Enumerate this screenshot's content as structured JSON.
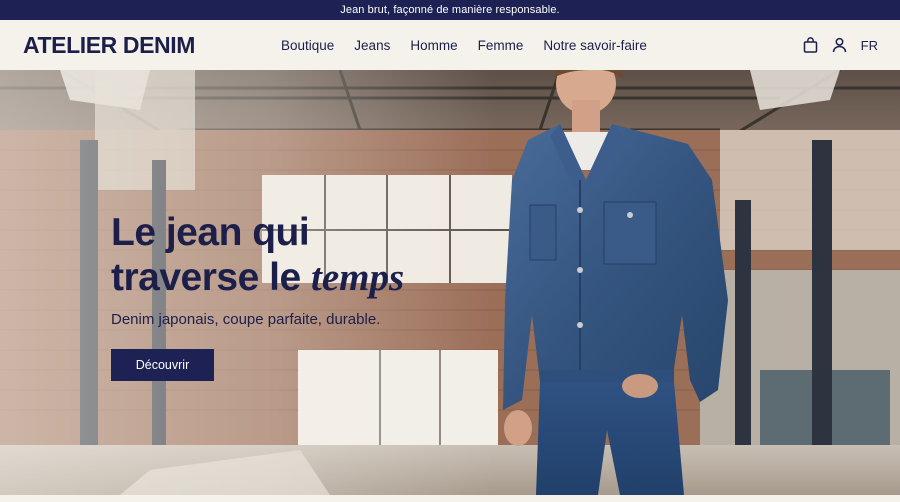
{
  "announcement": {
    "text": "Jean brut, façonné de manière responsable."
  },
  "header": {
    "logo": "ATELIER DENIM",
    "nav": [
      {
        "label": "Boutique"
      },
      {
        "label": "Jeans"
      },
      {
        "label": "Homme"
      },
      {
        "label": "Femme"
      },
      {
        "label": "Notre savoir-faire"
      }
    ],
    "icons": [
      "shopping-bag-icon",
      "user-icon"
    ],
    "language": "FR"
  },
  "hero": {
    "title_line1": "Le jean qui",
    "title_line2_plain": "traverse le ",
    "title_line2_italic": "temps",
    "subtitle": "Denim japonais, coupe parfaite, durable.",
    "cta_label": "Découvrir",
    "image": "man-in-denim-jacket-industrial-warehouse"
  },
  "colors": {
    "navy": "#1e2154",
    "cream": "#f5f2ec",
    "denim": "#3a5a8a"
  }
}
